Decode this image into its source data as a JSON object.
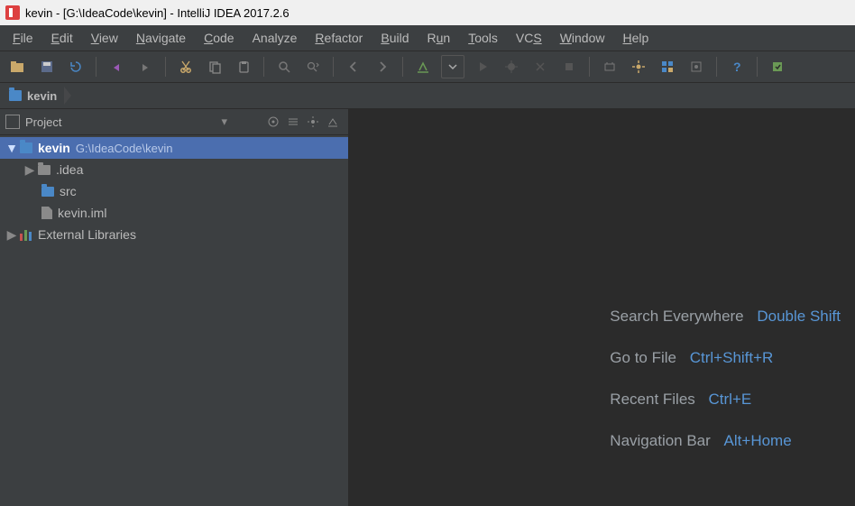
{
  "window": {
    "title": "kevin - [G:\\IdeaCode\\kevin] - IntelliJ IDEA 2017.2.6"
  },
  "menu": {
    "items": [
      "File",
      "Edit",
      "View",
      "Navigate",
      "Code",
      "Analyze",
      "Refactor",
      "Build",
      "Run",
      "Tools",
      "VCS",
      "Window",
      "Help"
    ]
  },
  "toolbar": {
    "icons": [
      "open-icon",
      "save-all-icon",
      "sync-icon",
      "undo-icon",
      "redo-icon",
      "cut-icon",
      "copy-icon",
      "paste-icon",
      "find-icon",
      "replace-icon",
      "back-icon",
      "forward-icon",
      "make-project-icon",
      "run-config-dropdown",
      "run-icon",
      "debug-icon",
      "coverage-icon",
      "stop-icon",
      "attach-icon",
      "settings-icon",
      "project-structure-icon",
      "sdk-icon",
      "help-icon",
      "update-icon"
    ]
  },
  "breadcrumb": {
    "root": "kevin"
  },
  "project_pane": {
    "title": "Project",
    "header_icons": [
      "locate-icon",
      "collapse-all-icon",
      "settings-gear-icon",
      "hide-icon"
    ]
  },
  "tree": {
    "root": {
      "name": "kevin",
      "path": "G:\\IdeaCode\\kevin"
    },
    "children": [
      {
        "name": ".idea",
        "type": "folder"
      },
      {
        "name": "src",
        "type": "folder-blue"
      },
      {
        "name": "kevin.iml",
        "type": "file"
      }
    ],
    "external_libs": "External Libraries"
  },
  "hints": [
    {
      "label": "Search Everywhere",
      "shortcut": "Double Shift"
    },
    {
      "label": "Go to File",
      "shortcut": "Ctrl+Shift+R"
    },
    {
      "label": "Recent Files",
      "shortcut": "Ctrl+E"
    },
    {
      "label": "Navigation Bar",
      "shortcut": "Alt+Home"
    }
  ]
}
